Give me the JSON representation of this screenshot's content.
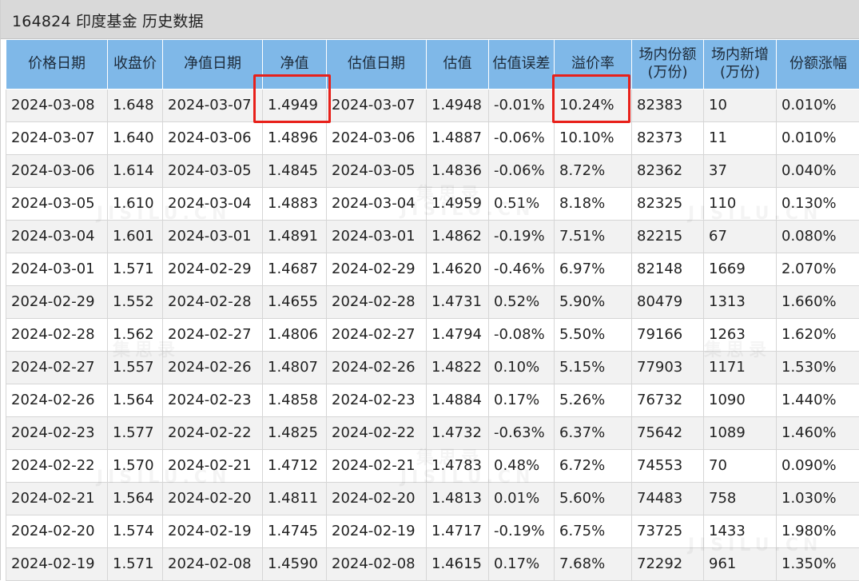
{
  "title": "164824 印度基金 历史数据",
  "columns": [
    "价格日期",
    "收盘价",
    "净值日期",
    "净值",
    "估值日期",
    "估值",
    "估值误差",
    "溢价率",
    "场内份额\n(万份)",
    "场内新增\n(万份)",
    "份额涨幅"
  ],
  "rows": [
    [
      "2024-03-08",
      "1.648",
      "2024-03-07",
      "1.4949",
      "2024-03-07",
      "1.4948",
      "-0.01%",
      "10.24%",
      "82383",
      "10",
      "0.010%"
    ],
    [
      "2024-03-07",
      "1.640",
      "2024-03-06",
      "1.4896",
      "2024-03-06",
      "1.4887",
      "-0.06%",
      "10.10%",
      "82373",
      "11",
      "0.010%"
    ],
    [
      "2024-03-06",
      "1.614",
      "2024-03-05",
      "1.4845",
      "2024-03-05",
      "1.4836",
      "-0.06%",
      "8.72%",
      "82362",
      "37",
      "0.040%"
    ],
    [
      "2024-03-05",
      "1.610",
      "2024-03-04",
      "1.4883",
      "2024-03-04",
      "1.4959",
      "0.51%",
      "8.18%",
      "82325",
      "110",
      "0.130%"
    ],
    [
      "2024-03-04",
      "1.601",
      "2024-03-01",
      "1.4891",
      "2024-03-01",
      "1.4862",
      "-0.19%",
      "7.51%",
      "82215",
      "67",
      "0.080%"
    ],
    [
      "2024-03-01",
      "1.571",
      "2024-02-29",
      "1.4687",
      "2024-02-29",
      "1.4620",
      "-0.46%",
      "6.97%",
      "82148",
      "1669",
      "2.070%"
    ],
    [
      "2024-02-29",
      "1.552",
      "2024-02-28",
      "1.4655",
      "2024-02-28",
      "1.4731",
      "0.52%",
      "5.90%",
      "80479",
      "1313",
      "1.660%"
    ],
    [
      "2024-02-28",
      "1.562",
      "2024-02-27",
      "1.4806",
      "2024-02-27",
      "1.4794",
      "-0.08%",
      "5.50%",
      "79166",
      "1263",
      "1.620%"
    ],
    [
      "2024-02-27",
      "1.557",
      "2024-02-26",
      "1.4807",
      "2024-02-26",
      "1.4822",
      "0.10%",
      "5.15%",
      "77903",
      "1171",
      "1.530%"
    ],
    [
      "2024-02-26",
      "1.564",
      "2024-02-23",
      "1.4858",
      "2024-02-23",
      "1.4884",
      "0.17%",
      "5.26%",
      "76732",
      "1090",
      "1.440%"
    ],
    [
      "2024-02-23",
      "1.577",
      "2024-02-22",
      "1.4825",
      "2024-02-22",
      "1.4732",
      "-0.63%",
      "6.37%",
      "75642",
      "1089",
      "1.460%"
    ],
    [
      "2024-02-22",
      "1.570",
      "2024-02-21",
      "1.4712",
      "2024-02-21",
      "1.4783",
      "0.48%",
      "6.72%",
      "74553",
      "70",
      "0.090%"
    ],
    [
      "2024-02-21",
      "1.564",
      "2024-02-20",
      "1.4811",
      "2024-02-20",
      "1.4813",
      "0.01%",
      "5.60%",
      "74483",
      "758",
      "1.030%"
    ],
    [
      "2024-02-20",
      "1.574",
      "2024-02-19",
      "1.4745",
      "2024-02-19",
      "1.4717",
      "-0.19%",
      "6.75%",
      "73725",
      "1433",
      "1.980%"
    ],
    [
      "2024-02-19",
      "1.571",
      "2024-02-08",
      "1.4590",
      "2024-02-08",
      "1.4615",
      "0.17%",
      "7.68%",
      "72292",
      "961",
      "1.350%"
    ]
  ],
  "highlight_color": "#e8201a",
  "watermark_text": "JISILU.CN",
  "watermark_cn": "集思录"
}
